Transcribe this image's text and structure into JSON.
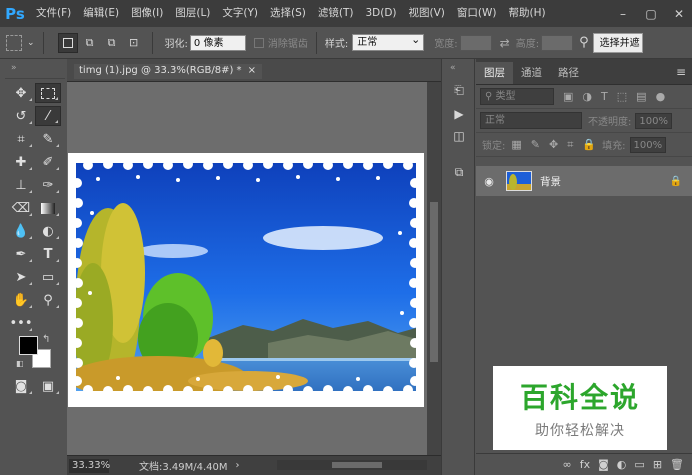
{
  "app": {
    "logo": "Ps"
  },
  "menu": [
    "文件(F)",
    "编辑(E)",
    "图像(I)",
    "图层(L)",
    "文字(Y)",
    "选择(S)",
    "滤镜(T)",
    "3D(D)",
    "视图(V)",
    "窗口(W)",
    "帮助(H)"
  ],
  "options": {
    "feather_label": "羽化:",
    "feather_value": "0 像素",
    "antialias_label": "消除锯齿",
    "style_label": "样式:",
    "style_value": "正常",
    "width_label": "宽度:",
    "height_label": "高度:",
    "select_mask_label": "选择并遮"
  },
  "document": {
    "tab_title": "timg (1).jpg @ 33.3%(RGB/8#) *",
    "close": "×",
    "zoom": "33.33%",
    "doc_info": "文档:3.49M/4.40M"
  },
  "colors": {
    "foreground": "#000000",
    "background": "#ffffff",
    "accent": "#31a8ff"
  },
  "layers_panel": {
    "tabs": [
      "图层",
      "通道",
      "路径"
    ],
    "filter_kind": "类型",
    "blend_mode": "正常",
    "opacity_label": "不透明度:",
    "opacity_value": "100%",
    "lock_label": "锁定:",
    "fill_label": "填充:",
    "fill_value": "100%",
    "layers": [
      {
        "name": "背景",
        "visible": true,
        "locked": true
      }
    ]
  },
  "watermark": {
    "title": "百科全说",
    "subtitle": "助你轻松解决"
  }
}
